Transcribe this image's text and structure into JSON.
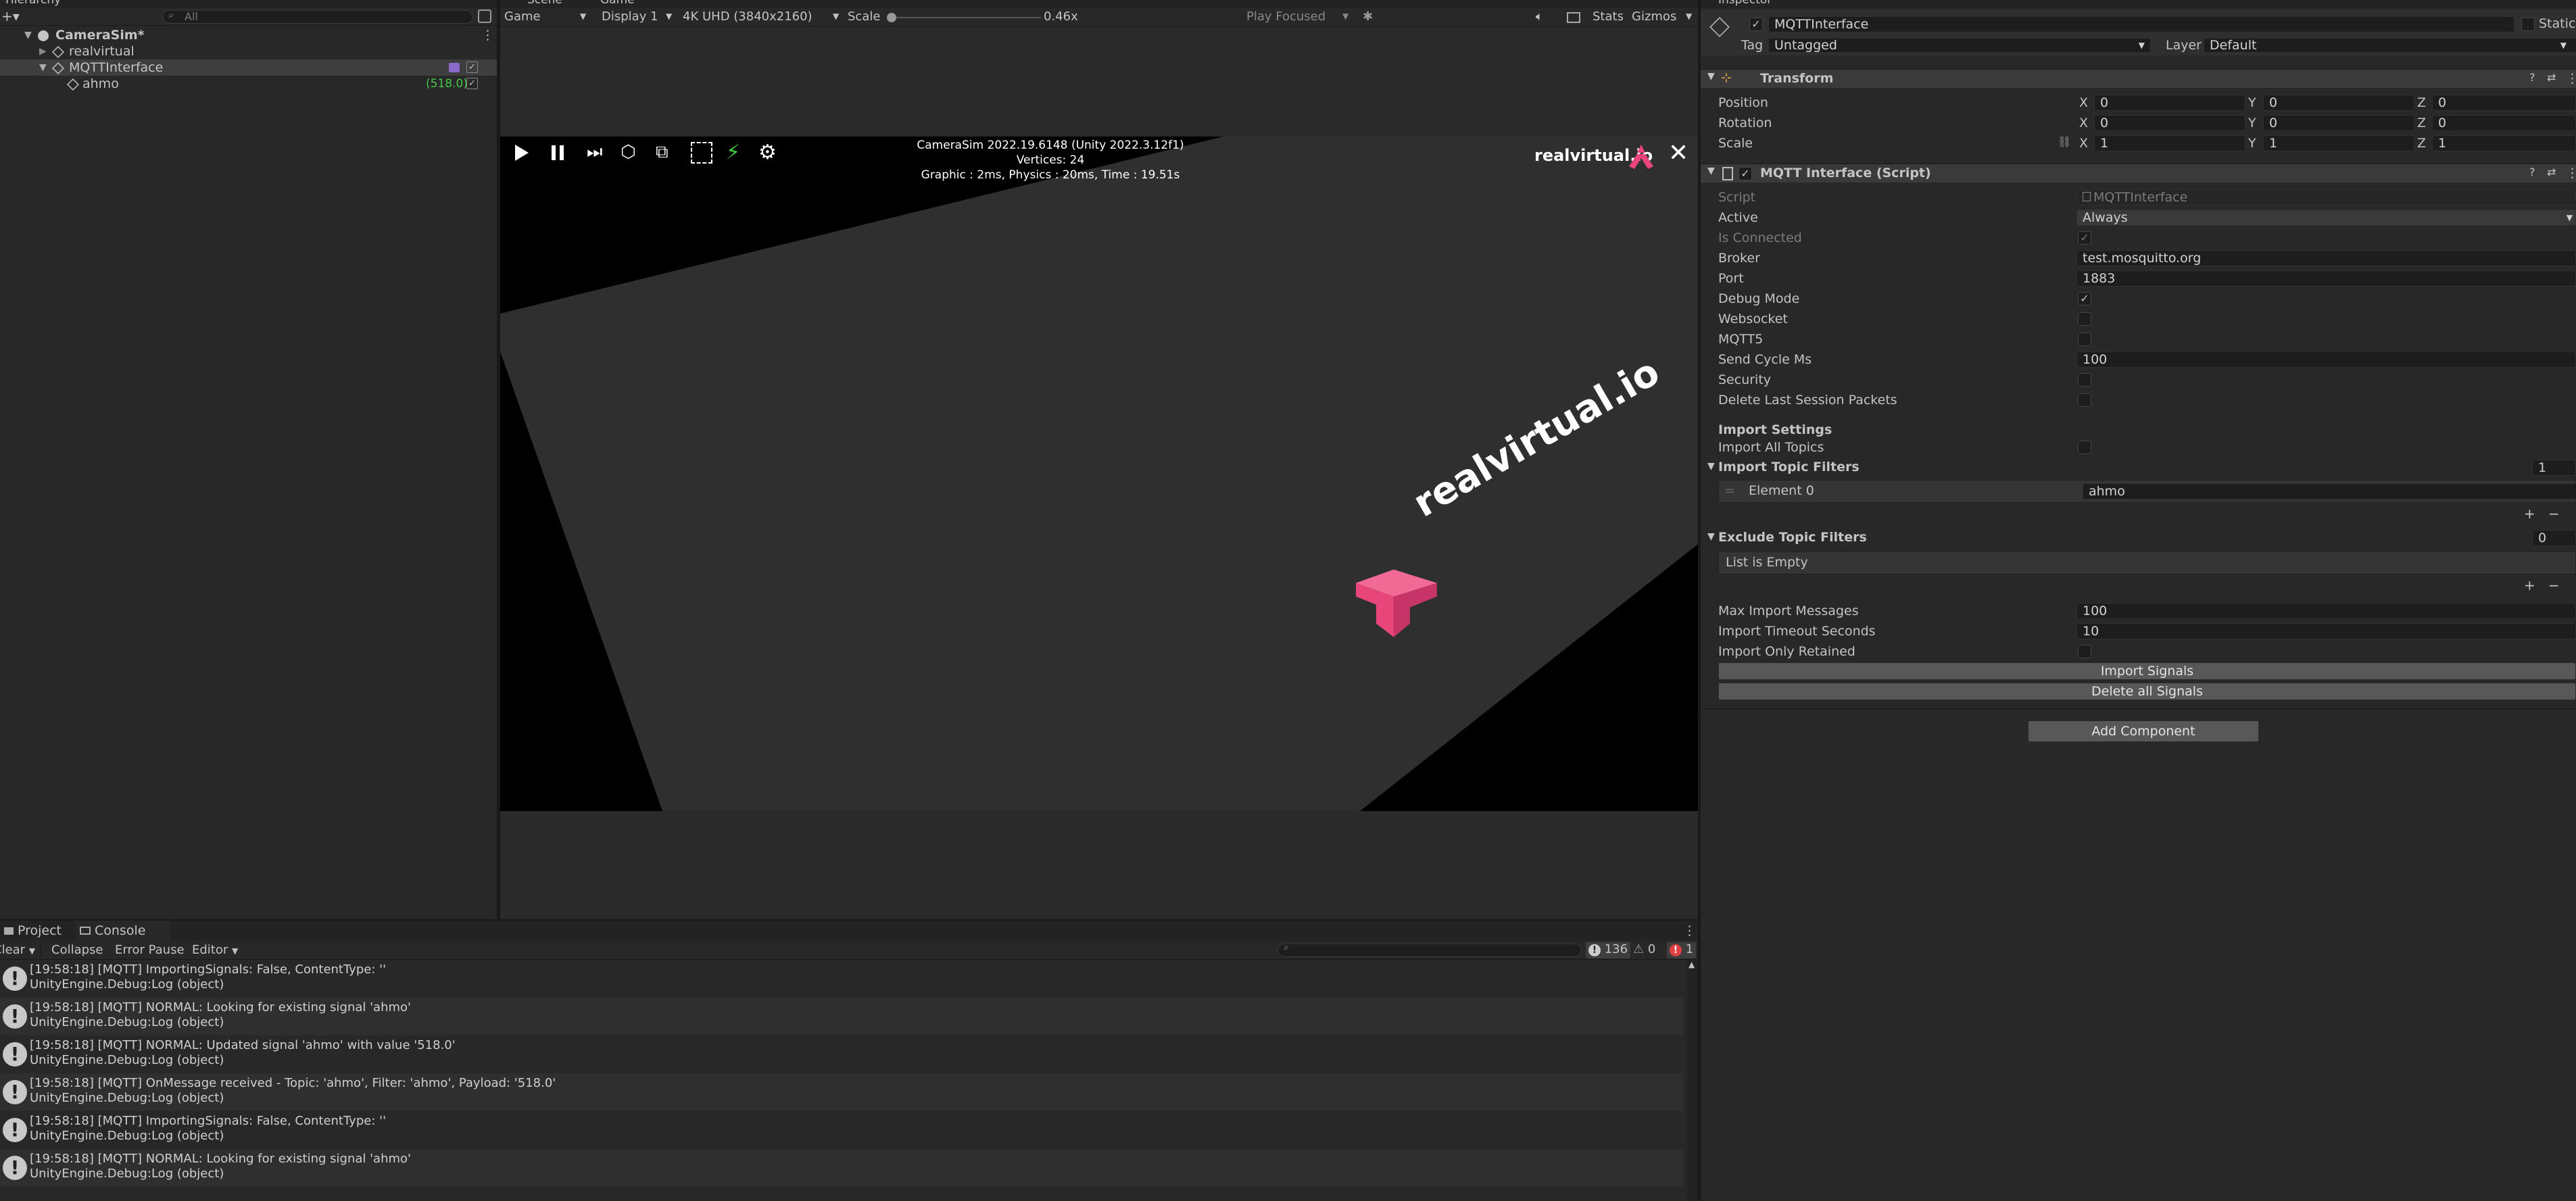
{
  "hierarchy": {
    "title": "Hierarchy",
    "search_placeholder": "All",
    "scene": "CameraSim*",
    "items": [
      {
        "label": "realvirtual"
      },
      {
        "label": "MQTTInterface"
      },
      {
        "label": "ahmo",
        "value": "(518.0)"
      }
    ]
  },
  "tabs": {
    "scene": "Scene",
    "game": "Game"
  },
  "game_toolbar": {
    "mode": "Game",
    "display": "Display 1",
    "resolution": "4K UHD (3840x2160)",
    "scale_label": "Scale",
    "scale_value": "0.46x",
    "play_mode": "Play Focused",
    "stats": "Stats",
    "gizmos": "Gizmos"
  },
  "game_view": {
    "info_line1": "CameraSim 2022.19.6148 (Unity 2022.3.12f1)",
    "info_line2": "Vertices: 24",
    "info_line3": "Graphic : 2ms, Physics : 20ms, Time : 19.51s",
    "brand": "realvirtual.io",
    "floor_logo": "realvirtual.io"
  },
  "inspector": {
    "title": "Inspector",
    "object_name": "MQTTInterface",
    "static_label": "Static",
    "tag_label": "Tag",
    "tag_value": "Untagged",
    "layer_label": "Layer",
    "layer_value": "Default",
    "transform": {
      "title": "Transform",
      "position_label": "Position",
      "rotation_label": "Rotation",
      "scale_label": "Scale",
      "position": [
        "0",
        "0",
        "0"
      ],
      "rotation": [
        "0",
        "0",
        "0"
      ],
      "scale": [
        "1",
        "1",
        "1"
      ],
      "axis_x": "X",
      "axis_y": "Y",
      "axis_z": "Z"
    },
    "component": {
      "title": "MQTT Interface (Script)",
      "script_label": "Script",
      "script_value": "MQTTInterface",
      "active_label": "Active",
      "active_value": "Always",
      "is_connected_label": "Is Connected",
      "broker_label": "Broker",
      "broker_value": "test.mosquitto.org",
      "port_label": "Port",
      "port_value": "1883",
      "debug_mode_label": "Debug Mode",
      "websocket_label": "Websocket",
      "mqtt5_label": "MQTT5",
      "send_cycle_label": "Send Cycle Ms",
      "send_cycle_value": "100",
      "security_label": "Security",
      "delete_last_label": "Delete Last Session Packets",
      "import_settings_label": "Import Settings",
      "import_all_label": "Import All Topics",
      "import_filters_label": "Import Topic Filters",
      "import_filters_count": "1",
      "element0_label": "Element 0",
      "element0_value": "ahmo",
      "exclude_filters_label": "Exclude Topic Filters",
      "exclude_filters_count": "0",
      "list_empty": "List is Empty",
      "max_import_label": "Max Import Messages",
      "max_import_value": "100",
      "timeout_label": "Import Timeout Seconds",
      "timeout_value": "10",
      "only_retained_label": "Import Only Retained",
      "import_signals_button": "Import Signals",
      "delete_signals_button": "Delete all Signals"
    },
    "add_component": "Add Component"
  },
  "console": {
    "tab_project": "Project",
    "tab_console": "Console",
    "clear": "Clear",
    "collapse": "Collapse",
    "error_pause": "Error Pause",
    "editor": "Editor",
    "log_count": "136",
    "warn_count": "0",
    "error_count": "1",
    "messages": [
      {
        "line1": "[19:58:18] [MQTT] ImportingSignals: False, ContentType: ''",
        "line2": "UnityEngine.Debug:Log (object)"
      },
      {
        "line1": "[19:58:18] [MQTT] NORMAL: Looking for existing signal 'ahmo'",
        "line2": "UnityEngine.Debug:Log (object)"
      },
      {
        "line1": "[19:58:18] [MQTT] NORMAL: Updated signal 'ahmo' with value '518.0'",
        "line2": "UnityEngine.Debug:Log (object)"
      },
      {
        "line1": "[19:58:18] [MQTT] OnMessage received - Topic: 'ahmo', Filter: 'ahmo', Payload: '518.0'",
        "line2": "UnityEngine.Debug:Log (object)"
      },
      {
        "line1": "[19:58:18] [MQTT] ImportingSignals: False, ContentType: ''",
        "line2": "UnityEngine.Debug:Log (object)"
      },
      {
        "line1": "[19:58:18] [MQTT] NORMAL: Looking for existing signal 'ahmo'",
        "line2": "UnityEngine.Debug:Log (object)"
      }
    ]
  },
  "colors": {
    "accent_pink": "#e8457a",
    "green_value": "#45c845",
    "panel_bg": "#282828"
  }
}
